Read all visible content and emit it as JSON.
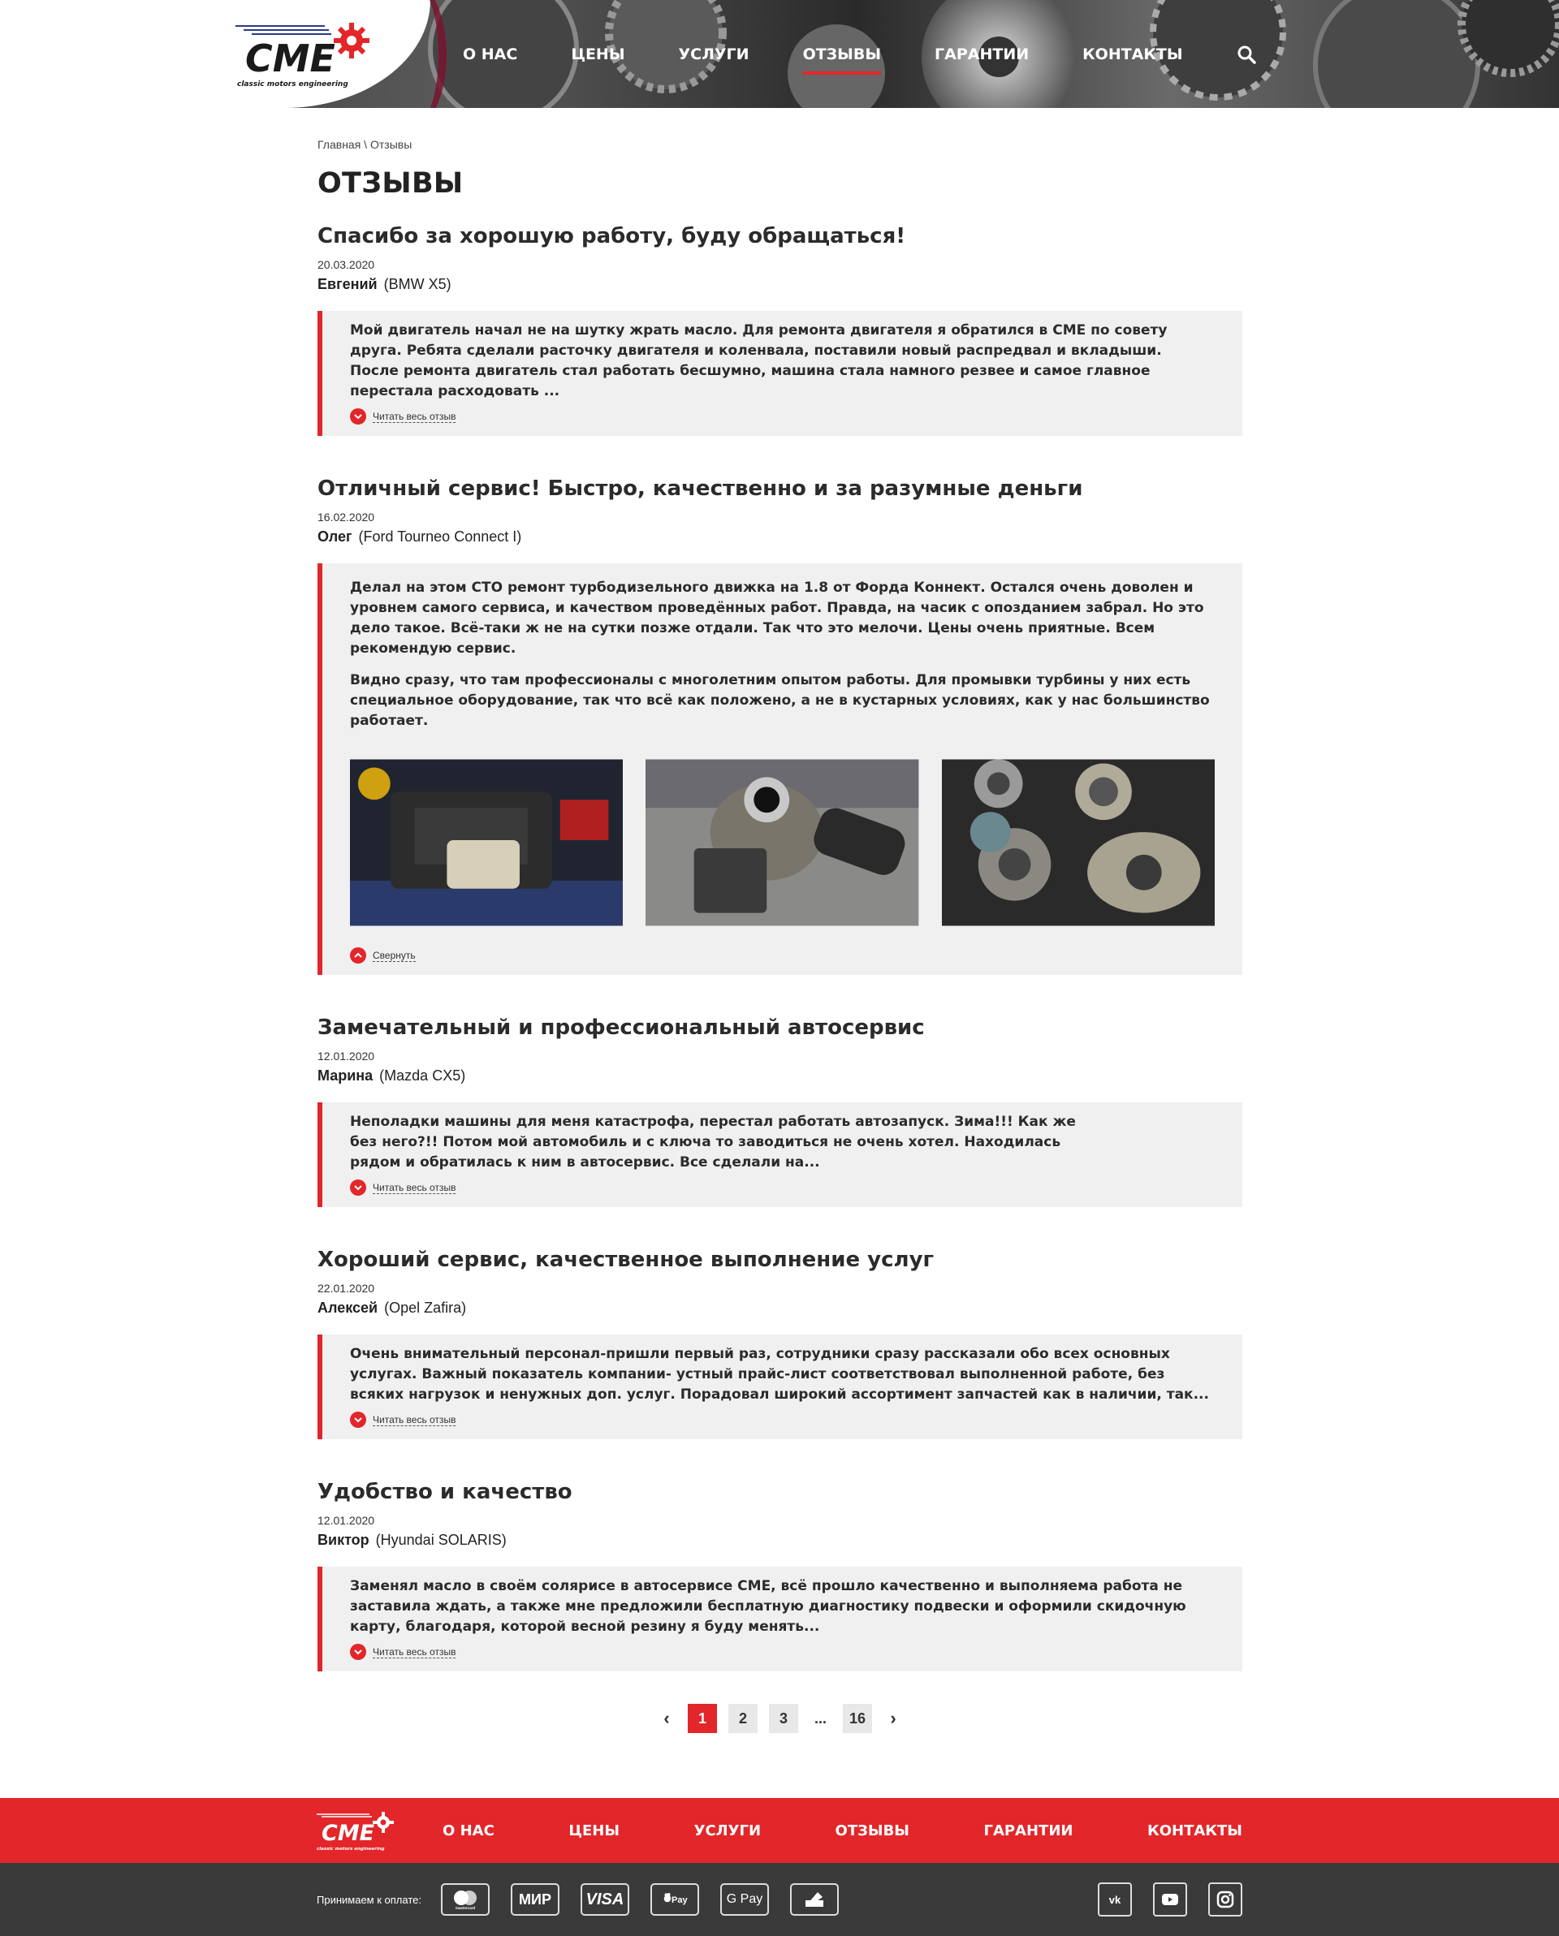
{
  "header": {
    "logo_text": "CME",
    "logo_subtext": "classic motors engineering",
    "nav": [
      {
        "label": "О НАС"
      },
      {
        "label": "ЦЕНЫ"
      },
      {
        "label": "УСЛУГИ"
      },
      {
        "label": "ОТЗЫВЫ",
        "active": true
      },
      {
        "label": "ГАРАНТИИ"
      },
      {
        "label": "КОНТАКТЫ"
      }
    ],
    "search_icon": "search-icon"
  },
  "breadcrumb": {
    "home": "Главная",
    "separator": " \\ ",
    "current": "Отзывы"
  },
  "page_title": "ОТЗЫВЫ",
  "reviews": [
    {
      "title": "Спасибо за хорошую работу, буду обращаться!",
      "date": "20.03.2020",
      "author": "Евгений",
      "car": "(BMW X5)",
      "paragraphs": [
        "Мой двигатель начал не на шутку жрать масло. Для ремонта двигателя я обратился в СМЕ по совету друга. Ребята сделали расточку двигателя и коленвала, поставили новый распредвал и вкладыши. После ремонта двигатель стал работать бесшумно, машина стала намного резвее и самое главное перестала расходовать ..."
      ],
      "toggle": "Читать весь отзыв"
    },
    {
      "title": "Отличный сервис! Быстро, качественно и за разумные деньги",
      "date": "16.02.2020",
      "author": "Олег",
      "car": "(Ford Tourneo Connect I)",
      "paragraphs": [
        "Делал на этом СТО ремонт турбодизельного движка на 1.8 от Форда Коннект. Остался очень доволен и уровнем самого сервиса, и качеством проведённых работ. Правда, на часик с опозданием забрал. Но это дело такое. Всё-таки ж не на сутки позже отдали. Так что это мелочи. Цены очень приятные. Всем рекомендую сервис.",
        "Видно сразу, что там профессионалы с многолетним опытом работы. Для промывки турбины у них есть специальное оборудование, так что всё как положено, а не в кустарных условиях, как у нас большинство работает."
      ],
      "toggle": "Свернуть"
    },
    {
      "title": "Замечательный и профессиональный автосервис",
      "date": "12.01.2020",
      "author": "Марина",
      "car": "(Mazda  CX5)",
      "paragraphs": [
        "Неполадки машины для меня катастрофа, перестал работать автозапуск. Зима!!! Как же без него?!! Потом мой автомобиль и с ключа то заводиться не очень хотел. Находилась рядом и обратилась к ним в автосервис. Все сделали на..."
      ],
      "toggle": "Читать весь отзыв"
    },
    {
      "title": "Хороший сервис, качественное выполнение услуг",
      "date": "22.01.2020",
      "author": "Алексей",
      "car": "(Opel Zafira)",
      "paragraphs": [
        "Очень внимательный персонал-пришли первый раз, сотрудники сразу рассказали обо всех основных услугах. Важный показатель компании- устный прайс-лист соответствовал выполненной работе, без всяких нагрузок и ненужных доп. услуг. Порадовал широкий ассортимент запчастей как в наличии, так..."
      ],
      "toggle": "Читать весь отзыв"
    },
    {
      "title": "Удобство и качество",
      "date": "12.01.2020",
      "author": "Виктор",
      "car": "(Hyundai SOLARIS)",
      "paragraphs": [
        "Заменял масло в своём солярисе в автосервисе СМЕ, всё прошло качественно и выполняема работа не заставила ждать, а также мне предложили бесплатную диагностику подвески и оформили скидочную карту, благодаря, которой весной резину я буду менять..."
      ],
      "toggle": "Читать весь отзыв"
    }
  ],
  "pagination": {
    "prev": "‹",
    "pages": [
      "1",
      "2",
      "3"
    ],
    "dots": "...",
    "last": "16",
    "next": "›",
    "current": "1"
  },
  "footer": {
    "nav": [
      "О НАС",
      "ЦЕНЫ",
      "УСЛУГИ",
      "ОТЗЫВЫ",
      "ГАРАНТИИ",
      "КОНТАКТЫ"
    ],
    "payment_label": "Принимаем к оплате:",
    "payments": [
      "mastercard-icon",
      "mir-icon",
      "visa-icon",
      "apple-pay-icon",
      "google-pay-icon",
      "wallet-icon"
    ],
    "payment_texts": {
      "mir": "МИР",
      "visa": "VISA",
      "apple_pay": "Pay",
      "google_pay": "G Pay",
      "mastercard_sub": "mastercard"
    },
    "social": [
      "vk-icon",
      "youtube-icon",
      "instagram-icon"
    ]
  },
  "colors": {
    "accent": "#e2262a",
    "dark": "#3a3a3a",
    "panel": "#f0f0f0"
  }
}
